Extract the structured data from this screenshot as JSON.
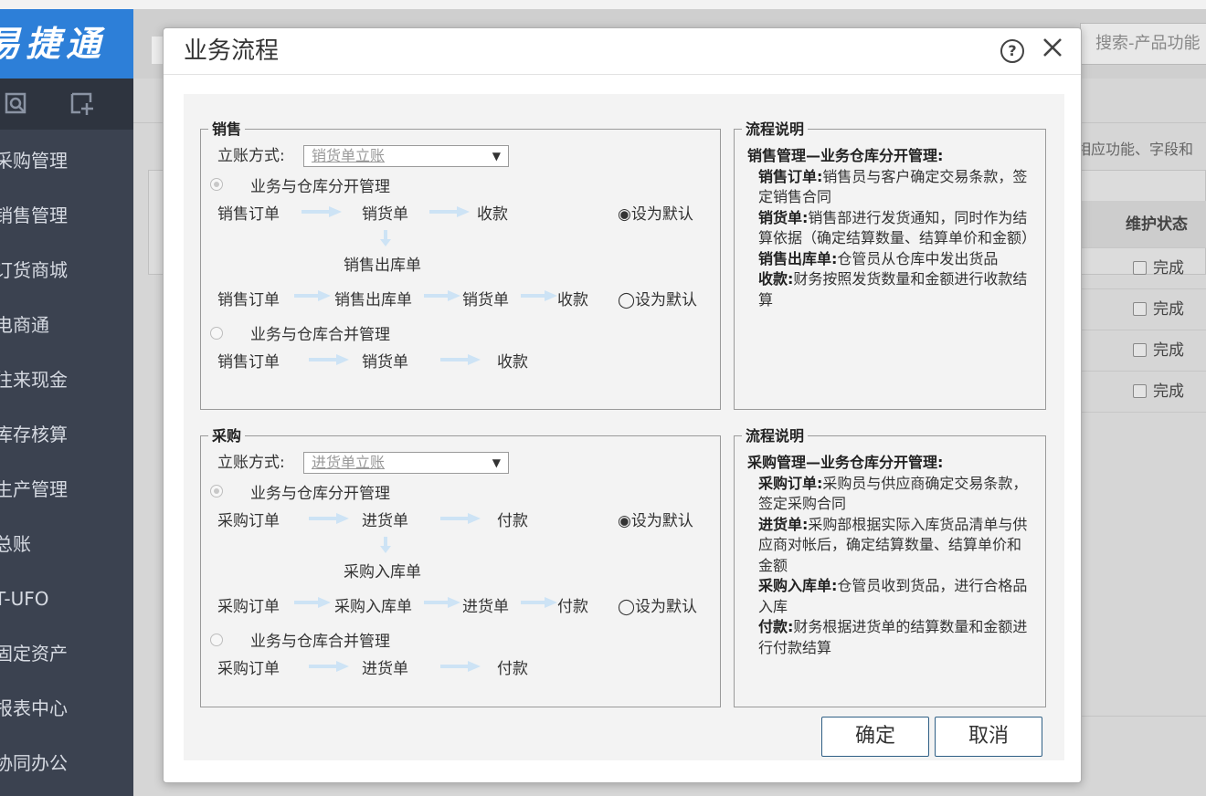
{
  "app": {
    "logo_text": "易捷通",
    "sidebar_items": [
      "采购管理",
      "销售管理",
      "订货商城",
      "电商通",
      "往来现金",
      "库存核算",
      "生产管理",
      "总账",
      "T-UFO",
      "固定资产",
      "报表中心",
      "协同办公"
    ]
  },
  "background": {
    "search_placeholder": "搜索-产品功能",
    "hint_text": "相应功能、字段和",
    "table_header": "维护状态",
    "rows": [
      "完成",
      "完成",
      "完成",
      "完成"
    ]
  },
  "dialog": {
    "title": "业务流程",
    "sales": {
      "legend": "销售",
      "mode_label": "立账方式:",
      "mode_value": "销货单立账",
      "option1": "业务与仓库分开管理",
      "flow1": [
        "销售订单",
        "销货单",
        "收款"
      ],
      "set_default_1": "◉设为默认",
      "flow1_sub": "销售出库单",
      "flow2": [
        "销售订单",
        "销售出库单",
        "销货单",
        "收款"
      ],
      "set_default_2": "◯设为默认",
      "option2": "业务与仓库合并管理",
      "flow3": [
        "销售订单",
        "销货单",
        "收款"
      ]
    },
    "sales_desc": {
      "legend": "流程说明",
      "heading": "销售管理—业务仓库分开管理:",
      "items": [
        {
          "term": "销售订单:",
          "text": "销售员与客户确定交易条款，签定销售合同"
        },
        {
          "term": "销货单:",
          "text": "销售部进行发货通知，同时作为结算依据（确定结算数量、结算单价和金额）"
        },
        {
          "term": "销售出库单:",
          "text": "仓管员从仓库中发出货品"
        },
        {
          "term": "收款:",
          "text": "财务按照发货数量和金额进行收款结算"
        }
      ]
    },
    "purchase": {
      "legend": "采购",
      "mode_label": "立账方式:",
      "mode_value": "进货单立账",
      "option1": "业务与仓库分开管理",
      "flow1": [
        "采购订单",
        "进货单",
        "付款"
      ],
      "set_default_1": "◉设为默认",
      "flow1_sub": "采购入库单",
      "flow2": [
        "采购订单",
        "采购入库单",
        "进货单",
        "付款"
      ],
      "set_default_2": "◯设为默认",
      "option2": "业务与仓库合并管理",
      "flow3": [
        "采购订单",
        "进货单",
        "付款"
      ]
    },
    "purchase_desc": {
      "legend": "流程说明",
      "heading": "采购管理—业务仓库分开管理:",
      "items": [
        {
          "term": "采购订单:",
          "text": "采购员与供应商确定交易条款，签定采购合同"
        },
        {
          "term": "进货单:",
          "text": "采购部根据实际入库货品清单与供应商对帐后，确定结算数量、结算单价和金额"
        },
        {
          "term": "采购入库单:",
          "text": "仓管员收到货品，进行合格品入库"
        },
        {
          "term": "付款:",
          "text": "财务根据进货单的结算数量和金额进行付款结算"
        }
      ]
    },
    "ok_label": "确定",
    "cancel_label": "取消",
    "help_icon": "question-circle-icon",
    "close_icon": "close-icon"
  }
}
